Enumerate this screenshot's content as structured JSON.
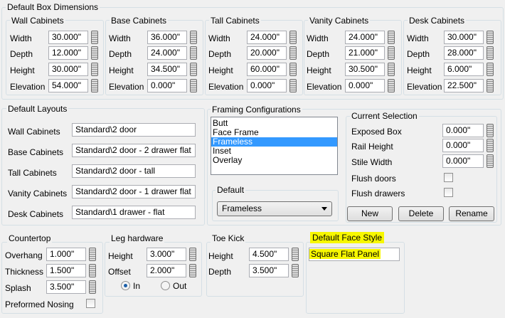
{
  "default_box_dimensions": {
    "title": "Default Box Dimensions",
    "groups": [
      {
        "title": "Wall Cabinets",
        "width": "30.000\"",
        "depth": "12.000\"",
        "height": "30.000\"",
        "elevation": "54.000\""
      },
      {
        "title": "Base Cabinets",
        "width": "36.000\"",
        "depth": "24.000\"",
        "height": "34.500\"",
        "elevation": "0.000\""
      },
      {
        "title": "Tall Cabinets",
        "width": "24.000\"",
        "depth": "20.000\"",
        "height": "60.000\"",
        "elevation": "0.000\""
      },
      {
        "title": "Vanity Cabinets",
        "width": "24.000\"",
        "depth": "21.000\"",
        "height": "30.500\"",
        "elevation": "0.000\""
      },
      {
        "title": "Desk Cabinets",
        "width": "30.000\"",
        "depth": "28.000\"",
        "height": "6.000\"",
        "elevation": "22.500\""
      }
    ],
    "labels": {
      "width": "Width",
      "depth": "Depth",
      "height": "Height",
      "elevation": "Elevation"
    }
  },
  "default_layouts": {
    "title": "Default Layouts",
    "rows": [
      {
        "label": "Wall Cabinets",
        "value": "Standard\\2 door"
      },
      {
        "label": "Base Cabinets",
        "value": "Standard\\2 door - 2 drawer flat"
      },
      {
        "label": "Tall Cabinets",
        "value": "Standard\\2 door - tall"
      },
      {
        "label": "Vanity Cabinets",
        "value": "Standard\\2 door - 1 drawer flat"
      },
      {
        "label": "Desk Cabinets",
        "value": "Standard\\1 drawer - flat"
      }
    ]
  },
  "framing": {
    "title": "Framing Configurations",
    "items": [
      "Butt",
      "Face Frame",
      "Frameless",
      "Inset",
      "Overlay"
    ],
    "selected": "Frameless",
    "default_title": "Default",
    "default_value": "Frameless"
  },
  "current_selection": {
    "title": "Current Selection",
    "exposed_box_label": "Exposed Box",
    "exposed_box": "0.000\"",
    "rail_height_label": "Rail Height",
    "rail_height": "0.000\"",
    "stile_width_label": "Stile Width",
    "stile_width": "0.000\"",
    "flush_doors_label": "Flush doors",
    "flush_drawers_label": "Flush drawers",
    "new_label": "New",
    "delete_label": "Delete",
    "rename_label": "Rename"
  },
  "countertop": {
    "title": "Countertop",
    "overhang_label": "Overhang",
    "overhang": "1.000\"",
    "thickness_label": "Thickness",
    "thickness": "1.500\"",
    "splash_label": "Splash",
    "splash": "3.500\"",
    "preformed_label": "Preformed Nosing"
  },
  "leg_hardware": {
    "title": "Leg hardware",
    "height_label": "Height",
    "height": "3.000\"",
    "offset_label": "Offset",
    "offset": "2.000\"",
    "in_label": "In",
    "out_label": "Out"
  },
  "toe_kick": {
    "title": "Toe Kick",
    "height_label": "Height",
    "height": "4.500\"",
    "depth_label": "Depth",
    "depth": "3.500\""
  },
  "face_style": {
    "title": "Default Face Style",
    "value": "Square Flat Panel",
    "highlight_color": "#f7f700"
  }
}
